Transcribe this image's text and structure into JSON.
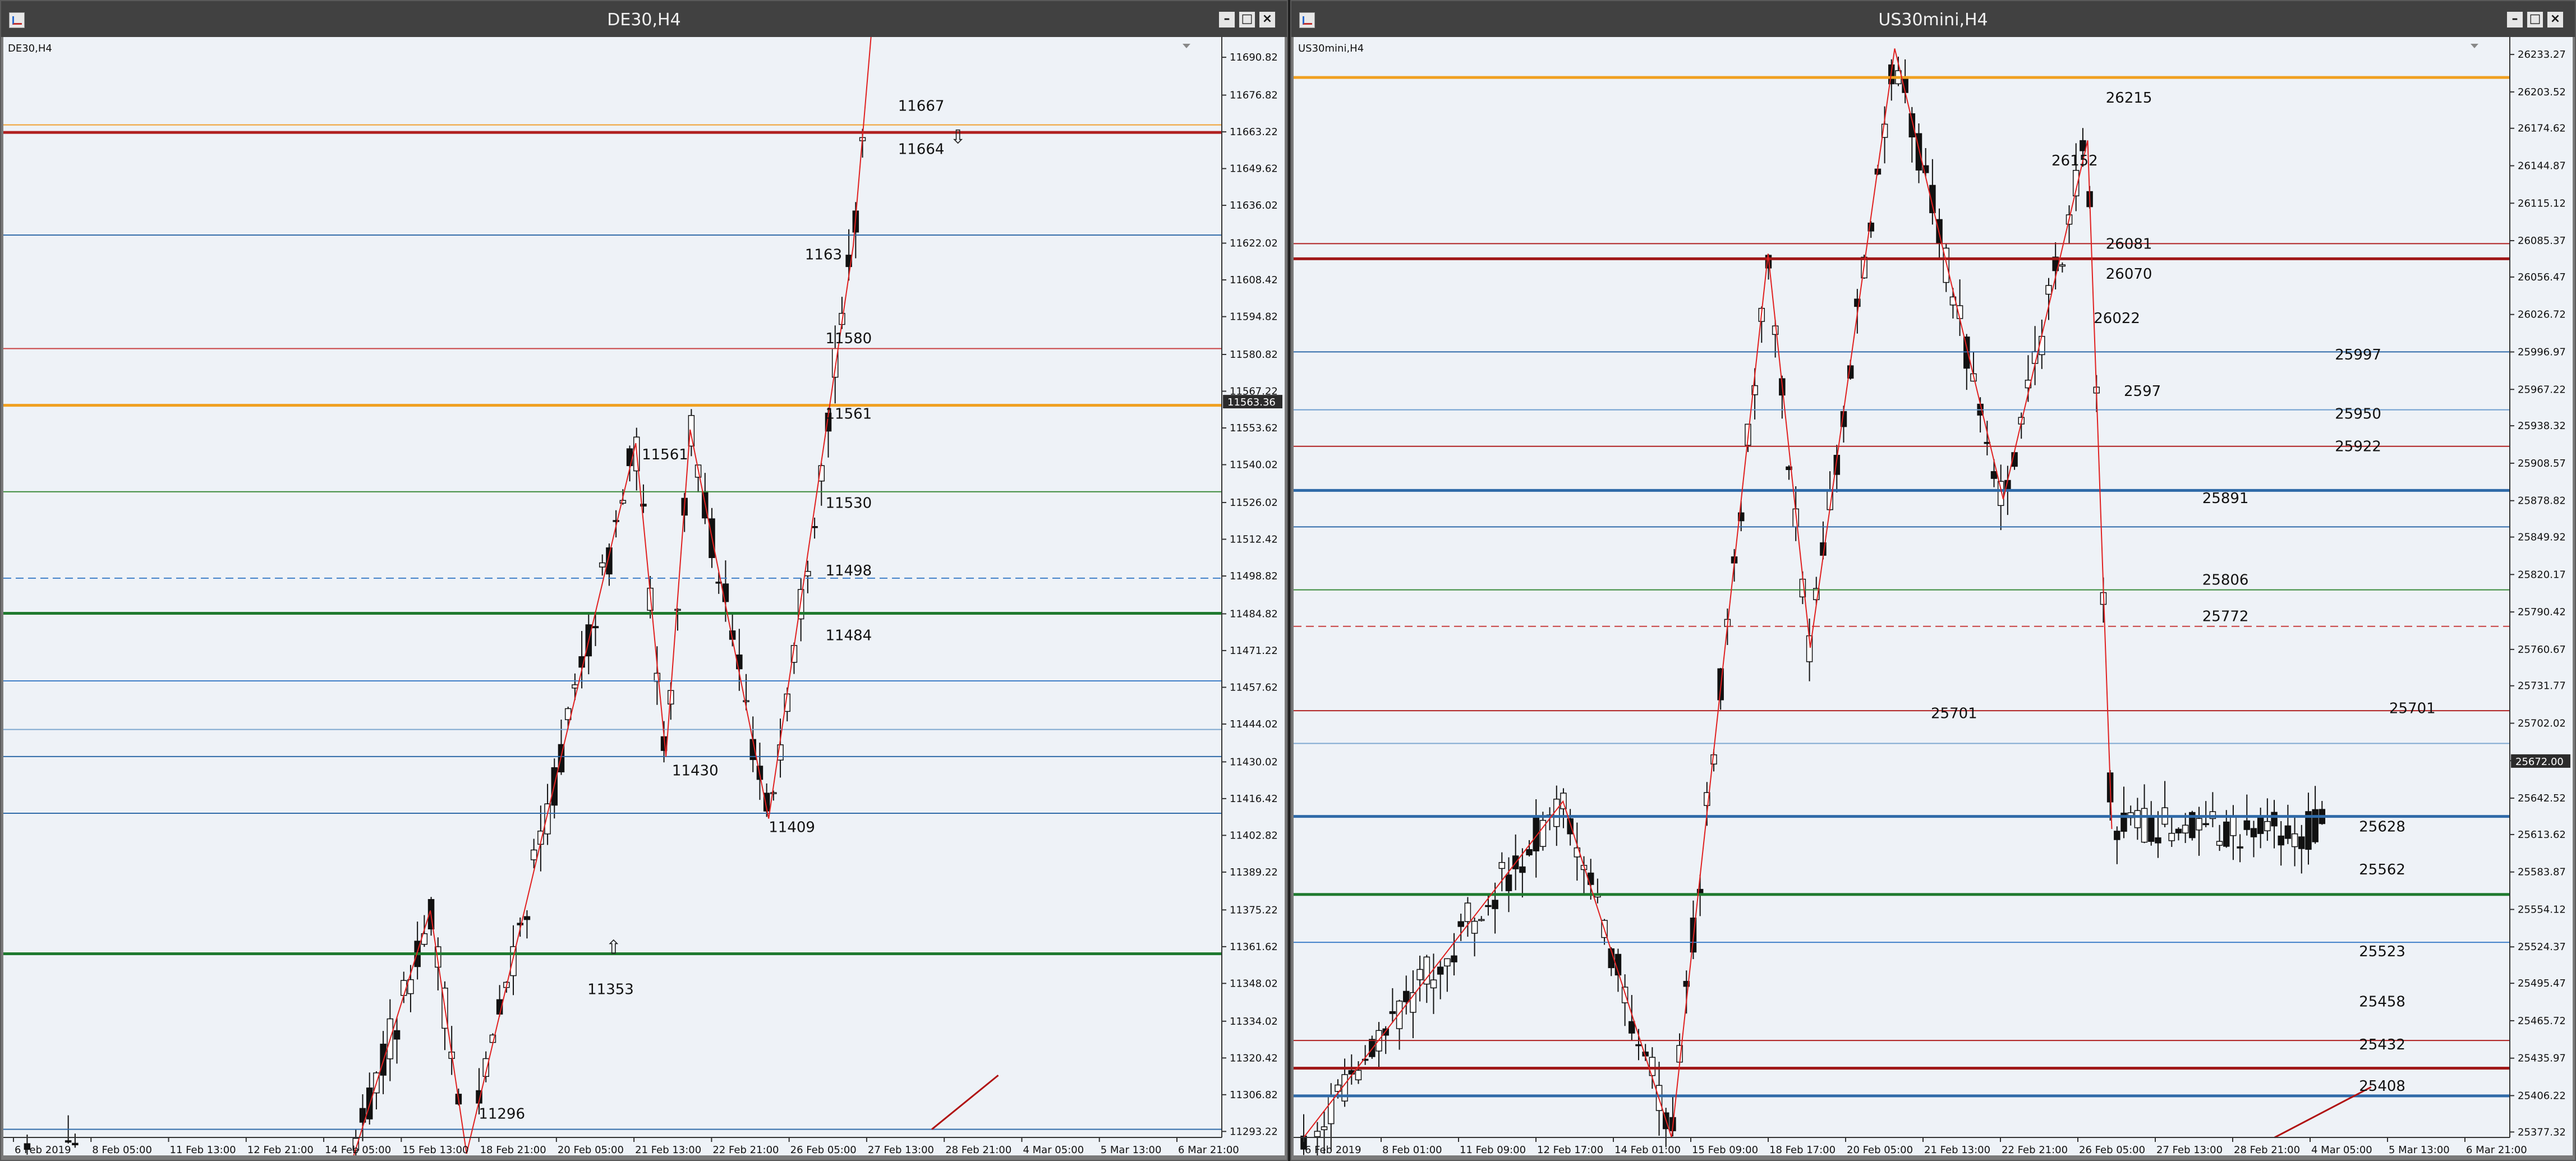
{
  "windows": [
    {
      "title": "DE30,H4",
      "symbol_label": "DE30,H4",
      "controls": [
        "minimize",
        "maximize",
        "close"
      ],
      "price_axis": {
        "ticks": [
          "11690.82",
          "11676.82",
          "11663.22",
          "11649.62",
          "11636.02",
          "11622.02",
          "11608.42",
          "11594.82",
          "11580.82",
          "11567.22",
          "11553.62",
          "11540.02",
          "11526.02",
          "11512.42",
          "11498.82",
          "11484.82",
          "11471.22",
          "11457.62",
          "11444.02",
          "11430.02",
          "11416.42",
          "11402.82",
          "11389.22",
          "11375.22",
          "11361.62",
          "11348.02",
          "11334.02",
          "11320.42",
          "11306.82",
          "11293.22"
        ],
        "range": [
          11291,
          11695
        ],
        "current_price": "11563.36"
      },
      "time_axis": [
        "6 Feb 2019",
        "8 Feb 05:00",
        "11 Feb 13:00",
        "12 Feb 21:00",
        "14 Feb 05:00",
        "15 Feb 13:00",
        "18 Feb 21:00",
        "20 Feb 05:00",
        "21 Feb 13:00",
        "22 Feb 21:00",
        "26 Feb 05:00",
        "27 Feb 13:00",
        "28 Feb 21:00",
        "4 Mar 05:00",
        "5 Mar 13:00",
        "6 Mar 21:00"
      ],
      "levels": [
        {
          "price": 11665.8,
          "color": "#f0a030",
          "style": "solid",
          "weight": "thin"
        },
        {
          "price": 11663.0,
          "color": "#b02020",
          "style": "solid",
          "weight": "thick"
        },
        {
          "price": 11625.0,
          "color": "#2f6aa8",
          "style": "solid",
          "weight": "thin"
        },
        {
          "price": 11583.0,
          "color": "#c84040",
          "style": "solid",
          "weight": "thin"
        },
        {
          "price": 11562.0,
          "color": "#f0a020",
          "style": "solid",
          "weight": "thick"
        },
        {
          "price": 11530.0,
          "color": "#3a8a3a",
          "style": "solid",
          "weight": "thin"
        },
        {
          "price": 11498.0,
          "color": "#3f7fc8",
          "style": "dashed",
          "weight": "thin"
        },
        {
          "price": 11485.0,
          "color": "#1f7a2f",
          "style": "solid",
          "weight": "thick"
        },
        {
          "price": 11460.0,
          "color": "#3f7fc8",
          "style": "solid",
          "weight": "thin"
        },
        {
          "price": 11442.0,
          "color": "#7fa8d0",
          "style": "solid",
          "weight": "thin"
        },
        {
          "price": 11432.0,
          "color": "#2f6aa8",
          "style": "solid",
          "weight": "thin"
        },
        {
          "price": 11411.0,
          "color": "#2f6aa8",
          "style": "solid",
          "weight": "thin"
        },
        {
          "price": 11359.0,
          "color": "#1f7a2f",
          "style": "solid",
          "weight": "thick"
        },
        {
          "price": 11294.0,
          "color": "#2f6aa8",
          "style": "solid",
          "weight": "thin"
        }
      ],
      "annotations": [
        {
          "text": "11667",
          "t": 0.732,
          "price": 11671
        },
        {
          "text": "11664",
          "t": 0.732,
          "price": 11655
        },
        {
          "text": "1163",
          "t": 0.655,
          "price": 11616
        },
        {
          "text": "11580",
          "t": 0.672,
          "price": 11585
        },
        {
          "text": "11561",
          "t": 0.672,
          "price": 11557
        },
        {
          "text": "11561",
          "t": 0.52,
          "price": 11542
        },
        {
          "text": "11530",
          "t": 0.672,
          "price": 11524
        },
        {
          "text": "11498",
          "t": 0.672,
          "price": 11499
        },
        {
          "text": "11484",
          "t": 0.672,
          "price": 11475
        },
        {
          "text": "11430",
          "t": 0.545,
          "price": 11425
        },
        {
          "text": "11409",
          "t": 0.625,
          "price": 11404
        },
        {
          "text": "11353",
          "t": 0.475,
          "price": 11344
        },
        {
          "text": "11296",
          "t": 0.385,
          "price": 11298
        }
      ],
      "zigzag": [
        {
          "t": 0.28,
          "price": 11282
        },
        {
          "t": 0.345,
          "price": 11375
        },
        {
          "t": 0.375,
          "price": 11285
        },
        {
          "t": 0.515,
          "price": 11548
        },
        {
          "t": 0.54,
          "price": 11432
        },
        {
          "t": 0.56,
          "price": 11553
        },
        {
          "t": 0.625,
          "price": 11409
        },
        {
          "t": 0.695,
          "price": 11621
        },
        {
          "t": 0.71,
          "price": 11700
        }
      ],
      "arrows": [
        {
          "dir": "down",
          "t": 0.775,
          "price": 11659
        },
        {
          "dir": "up",
          "t": 0.49,
          "price": 11359
        }
      ],
      "trend_segment": [
        {
          "t": 0.76,
          "price": 11294
        },
        {
          "t": 0.815,
          "price": 11314
        }
      ]
    },
    {
      "title": "US30mini,H4",
      "symbol_label": "US30mini,H4",
      "controls": [
        "minimize",
        "maximize",
        "close"
      ],
      "price_axis": {
        "ticks": [
          "26233.27",
          "26203.52",
          "26174.62",
          "26144.87",
          "26115.12",
          "26085.37",
          "26056.47",
          "26026.72",
          "25996.97",
          "25967.22",
          "25938.32",
          "25908.57",
          "25878.82",
          "25849.92",
          "25820.17",
          "25790.42",
          "25760.67",
          "25731.77",
          "25702.02",
          "25672.27",
          "25642.52",
          "25613.62",
          "25583.87",
          "25554.12",
          "25524.37",
          "25495.47",
          "25465.72",
          "25435.97",
          "25406.22",
          "25377.32"
        ],
        "range": [
          25373,
          26240
        ],
        "current_price": "25672.00"
      },
      "time_axis": [
        "6 Feb 2019",
        "8 Feb 01:00",
        "11 Feb 09:00",
        "12 Feb 17:00",
        "14 Feb 01:00",
        "15 Feb 09:00",
        "18 Feb 17:00",
        "20 Feb 05:00",
        "21 Feb 13:00",
        "22 Feb 21:00",
        "26 Feb 05:00",
        "27 Feb 13:00",
        "28 Feb 21:00",
        "4 Mar 05:00",
        "5 Mar 13:00",
        "6 Mar 21:00"
      ],
      "levels": [
        {
          "price": 26215.0,
          "color": "#f0a020",
          "style": "solid",
          "weight": "thick"
        },
        {
          "price": 26083.0,
          "color": "#b02020",
          "style": "solid",
          "weight": "thin"
        },
        {
          "price": 26071.0,
          "color": "#a01818",
          "style": "solid",
          "weight": "thick"
        },
        {
          "price": 25997.0,
          "color": "#2f6aa8",
          "style": "solid",
          "weight": "thin"
        },
        {
          "price": 25951.0,
          "color": "#6f9fd0",
          "style": "solid",
          "weight": "thin"
        },
        {
          "price": 25922.0,
          "color": "#b02020",
          "style": "solid",
          "weight": "thin"
        },
        {
          "price": 25887.0,
          "color": "#2f6aa8",
          "style": "solid",
          "weight": "thick"
        },
        {
          "price": 25858.0,
          "color": "#2f6aa8",
          "style": "solid",
          "weight": "thin"
        },
        {
          "price": 25808.0,
          "color": "#3a8a3a",
          "style": "solid",
          "weight": "thin"
        },
        {
          "price": 25779.0,
          "color": "#c84040",
          "style": "dashed",
          "weight": "thin"
        },
        {
          "price": 25712.0,
          "color": "#b02020",
          "style": "solid",
          "weight": "thin"
        },
        {
          "price": 25686.0,
          "color": "#7fa8d0",
          "style": "solid",
          "weight": "thin"
        },
        {
          "price": 25628.0,
          "color": "#2f6aa8",
          "style": "solid",
          "weight": "thick"
        },
        {
          "price": 25566.0,
          "color": "#1f7a2f",
          "style": "solid",
          "weight": "thick"
        },
        {
          "price": 25528.0,
          "color": "#3f7fc8",
          "style": "solid",
          "weight": "thin"
        },
        {
          "price": 25450.0,
          "color": "#b02020",
          "style": "solid",
          "weight": "thin"
        },
        {
          "price": 25428.0,
          "color": "#a01818",
          "style": "solid",
          "weight": "thick"
        },
        {
          "price": 25406.0,
          "color": "#2f6aa8",
          "style": "solid",
          "weight": "thick"
        }
      ],
      "annotations": [
        {
          "text": "26215",
          "t": 0.665,
          "price": 26195
        },
        {
          "text": "26152",
          "t": 0.62,
          "price": 26145
        },
        {
          "text": "26081",
          "t": 0.665,
          "price": 26079
        },
        {
          "text": "26070",
          "t": 0.665,
          "price": 26055
        },
        {
          "text": "26022",
          "t": 0.655,
          "price": 26020
        },
        {
          "text": "2597",
          "t": 0.68,
          "price": 25962
        },
        {
          "text": "25997",
          "t": 0.855,
          "price": 25991
        },
        {
          "text": "25950",
          "t": 0.855,
          "price": 25944
        },
        {
          "text": "25922",
          "t": 0.855,
          "price": 25918
        },
        {
          "text": "25891",
          "t": 0.745,
          "price": 25877
        },
        {
          "text": "25806",
          "t": 0.745,
          "price": 25812
        },
        {
          "text": "25772",
          "t": 0.745,
          "price": 25783
        },
        {
          "text": "25701",
          "t": 0.52,
          "price": 25706
        },
        {
          "text": "25701",
          "t": 0.9,
          "price": 25710
        },
        {
          "text": "25628",
          "t": 0.875,
          "price": 25616
        },
        {
          "text": "25562",
          "t": 0.875,
          "price": 25582
        },
        {
          "text": "25523",
          "t": 0.875,
          "price": 25517
        },
        {
          "text": "25458",
          "t": 0.875,
          "price": 25477
        },
        {
          "text": "25432",
          "t": 0.875,
          "price": 25443
        },
        {
          "text": "25408",
          "t": 0.875,
          "price": 25410
        }
      ],
      "zigzag": [
        {
          "t": 0.0,
          "price": 25373
        },
        {
          "t": 0.215,
          "price": 25640
        },
        {
          "t": 0.305,
          "price": 25373
        },
        {
          "t": 0.385,
          "price": 26075
        },
        {
          "t": 0.42,
          "price": 25762
        },
        {
          "t": 0.49,
          "price": 26238
        },
        {
          "t": 0.58,
          "price": 25880
        },
        {
          "t": 0.65,
          "price": 26165
        },
        {
          "t": 0.67,
          "price": 25618
        }
      ],
      "trend_segment": [
        {
          "t": 0.805,
          "price": 25373
        },
        {
          "t": 0.885,
          "price": 25413
        }
      ]
    }
  ]
}
